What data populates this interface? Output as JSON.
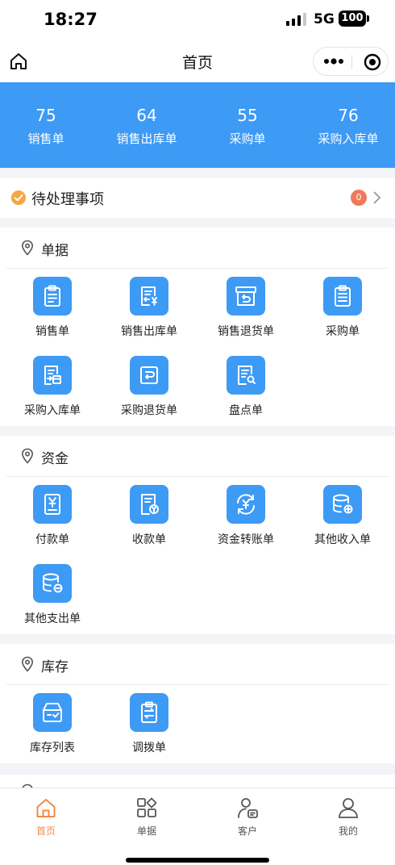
{
  "status_bar": {
    "time": "18:27",
    "network": "5G",
    "battery": "100"
  },
  "nav": {
    "title": "首页"
  },
  "stats": [
    {
      "value": "75",
      "label": "销售单"
    },
    {
      "value": "64",
      "label": "销售出库单"
    },
    {
      "value": "55",
      "label": "采购单"
    },
    {
      "value": "76",
      "label": "采购入库单"
    }
  ],
  "todo": {
    "label": "待处理事项",
    "badge": "0"
  },
  "sections": {
    "documents": {
      "title": "单据",
      "items": [
        {
          "label": "销售单",
          "icon": "clipboard-list-icon"
        },
        {
          "label": "销售出库单",
          "icon": "document-yen-out-icon"
        },
        {
          "label": "销售退货单",
          "icon": "return-box-icon"
        },
        {
          "label": "采购单",
          "icon": "clipboard-icon"
        },
        {
          "label": "采购入库单",
          "icon": "document-in-icon"
        },
        {
          "label": "采购退货单",
          "icon": "return-square-icon"
        },
        {
          "label": "盘点单",
          "icon": "document-search-icon"
        }
      ]
    },
    "funds": {
      "title": "资金",
      "items": [
        {
          "label": "付款单",
          "icon": "yen-document-icon"
        },
        {
          "label": "收款单",
          "icon": "receipt-yen-icon"
        },
        {
          "label": "资金转账单",
          "icon": "yen-transfer-icon"
        },
        {
          "label": "其他收入单",
          "icon": "database-plus-icon"
        },
        {
          "label": "其他支出单",
          "icon": "database-minus-icon"
        }
      ]
    },
    "inventory": {
      "title": "库存",
      "items": [
        {
          "label": "库存列表",
          "icon": "inbox-check-icon"
        },
        {
          "label": "调拨单",
          "icon": "clipboard-transfer-icon"
        }
      ]
    }
  },
  "tabs": [
    {
      "label": "首页",
      "icon": "home-icon",
      "active": true
    },
    {
      "label": "单据",
      "icon": "apps-icon",
      "active": false
    },
    {
      "label": "客户",
      "icon": "customer-icon",
      "active": false
    },
    {
      "label": "我的",
      "icon": "user-icon",
      "active": false
    }
  ],
  "colors": {
    "primary": "#3d9af5",
    "accent": "#f08a4b",
    "badge": "#f0795a",
    "check": "#f5a742"
  }
}
